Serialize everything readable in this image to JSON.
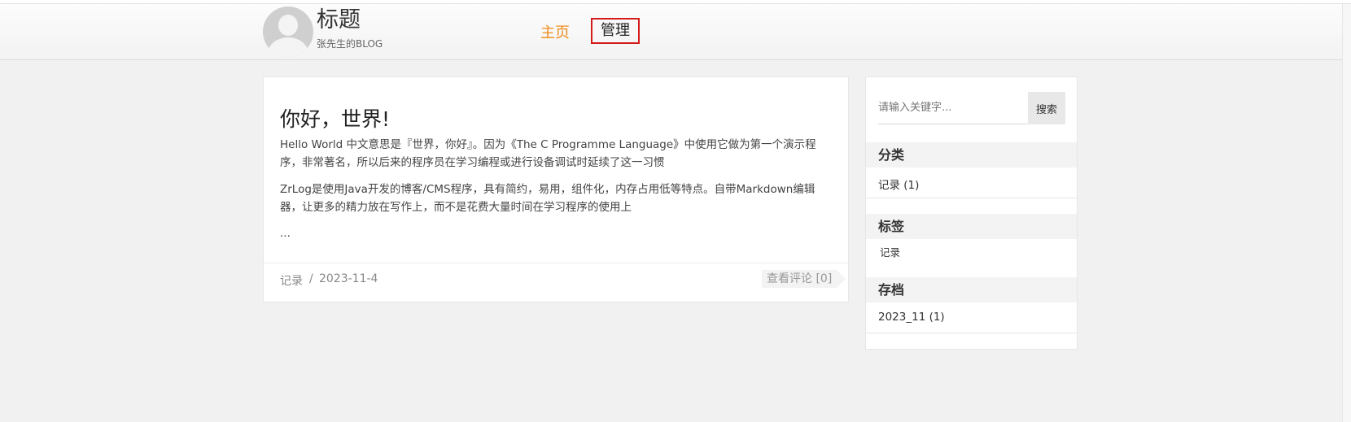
{
  "header": {
    "title": "标题",
    "subtitle": "张先生的BLOG",
    "nav": {
      "home": "主页",
      "admin": "管理"
    }
  },
  "post": {
    "title": "你好，世界!",
    "paragraphs": [
      "Hello World 中文意思是『世界，你好』。因为《The C Programme Language》中使用它做为第一个演示程序，非常著名，所以后来的程序员在学习编程或进行设备调试时延续了这一习惯",
      "ZrLog是使用Java开发的博客/CMS程序，具有简约，易用，组件化，内存占用低等特点。自带Markdown编辑器，让更多的精力放在写作上，而不是花费大量时间在学习程序的使用上",
      "..."
    ],
    "category": "记录",
    "separator": "/",
    "date": "2023-11-4",
    "comment_link": "查看评论 [0]"
  },
  "sidebar": {
    "search": {
      "placeholder": "请输入关键字...",
      "button": "搜索"
    },
    "categories": {
      "heading": "分类",
      "items": [
        "记录 (1)"
      ]
    },
    "tags": {
      "heading": "标签",
      "items": [
        "记录"
      ]
    },
    "archives": {
      "heading": "存档",
      "items": [
        "2023_11 (1)"
      ]
    }
  },
  "icons": {
    "avatar": "user-avatar-icon"
  },
  "colors": {
    "nav_active": "#f08b1a",
    "admin_border": "#d41b1b"
  }
}
